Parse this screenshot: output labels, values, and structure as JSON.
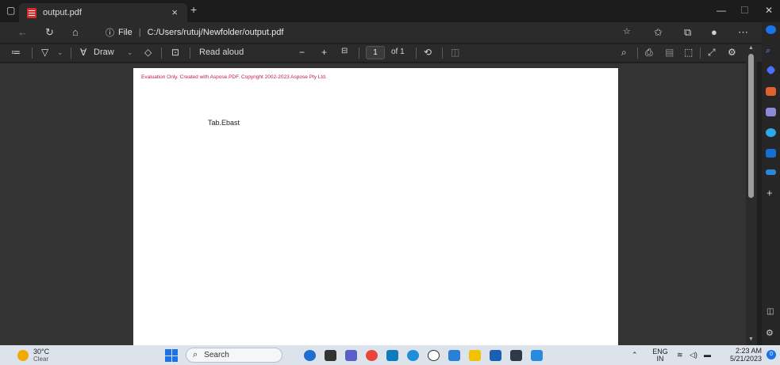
{
  "browser": {
    "tab_title": "output.pdf",
    "tab_close": "×",
    "new_tab": "+",
    "minimize": "—",
    "maximize": "☐",
    "close": "✕",
    "address_info": "File",
    "address_url": "C:/Users/rutuj/Newfolder/output.pdf"
  },
  "pdf_toolbar": {
    "draw_label": "Draw",
    "read_aloud_label": "Read aloud",
    "zoom_out": "−",
    "zoom_in": "+",
    "page_current": "1",
    "page_total": "of 1"
  },
  "document": {
    "watermark": "Evaluation Only. Created with Aspose.PDF. Copyright 2002-2023 Aspose Pty Ltd.",
    "body_text": "Tab.Ebast"
  },
  "taskbar": {
    "weather_temp": "30°C",
    "weather_desc": "Clear",
    "search_placeholder": "Search",
    "lang_line1": "ENG",
    "lang_line2": "IN",
    "time": "2:23 AM",
    "date": "5/21/2023",
    "notification_count": "0"
  },
  "colors": {
    "accent": "#1a73e8",
    "watermark": "#c2185b",
    "pdf_icon": "#d42b2b"
  }
}
